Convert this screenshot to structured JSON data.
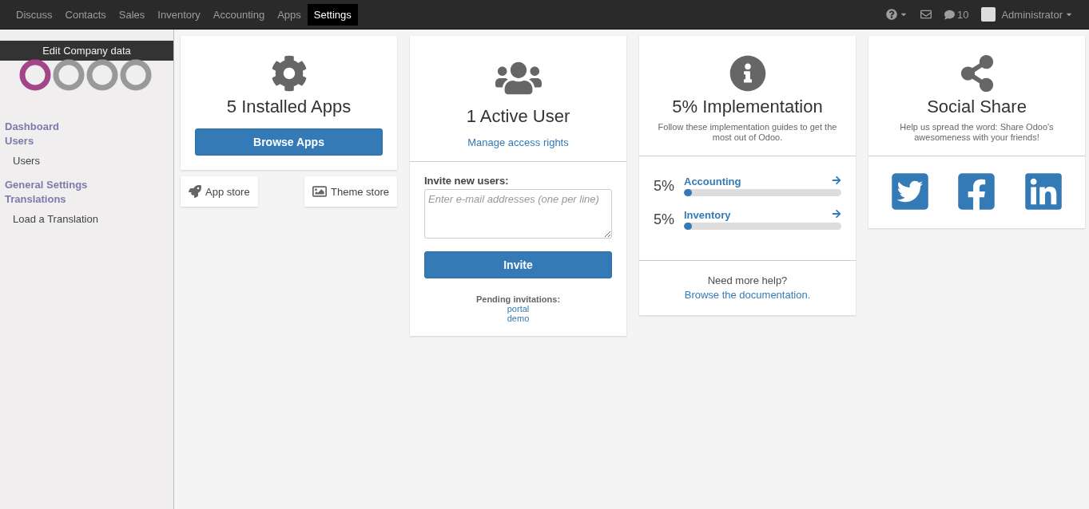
{
  "top_menu": [
    {
      "label": "Discuss",
      "selected": false
    },
    {
      "label": "Contacts",
      "selected": false
    },
    {
      "label": "Sales",
      "selected": false
    },
    {
      "label": "Inventory",
      "selected": false
    },
    {
      "label": "Accounting",
      "selected": false
    },
    {
      "label": "Apps",
      "selected": false
    },
    {
      "label": "Settings",
      "selected": true
    }
  ],
  "systray": {
    "chat_count": "10",
    "user": "Administrator"
  },
  "sidebar": {
    "edit_company": "Edit Company data",
    "items": [
      {
        "label": "Dashboard",
        "kind": "header"
      },
      {
        "label": "Users",
        "kind": "header"
      },
      {
        "label": "Users",
        "kind": "item"
      },
      {
        "label": "General Settings",
        "kind": "header"
      },
      {
        "label": "Translations",
        "kind": "header"
      },
      {
        "label": "Load a Translation",
        "kind": "item"
      }
    ]
  },
  "apps_card": {
    "title": "5 Installed Apps",
    "button": "Browse Apps",
    "app_store": "App store",
    "theme_store": "Theme store"
  },
  "users_card": {
    "title": "1 Active User",
    "link": "Manage access rights",
    "invite_label": "Invite new users:",
    "placeholder": "Enter e-mail addresses (one per line)",
    "button": "Invite",
    "pending_label": "Pending invitations:",
    "pending": [
      "portal",
      "demo"
    ]
  },
  "implementation_card": {
    "title": "5% Implementation",
    "subtitle": "Follow these implementation guides to get the most out of Odoo.",
    "guides": [
      {
        "percent": "5%",
        "name": "Accounting",
        "level": 0.05
      },
      {
        "percent": "5%",
        "name": "Inventory",
        "level": 0.05
      }
    ],
    "help_text": "Need more help?",
    "help_link": "Browse the documentation."
  },
  "share_card": {
    "title": "Social Share",
    "subtitle": "Help us spread the word: Share Odoo's awesomeness with your friends!",
    "networks": [
      {
        "kind": "twitter"
      },
      {
        "kind": "facebook"
      },
      {
        "kind": "linkedin"
      }
    ]
  }
}
